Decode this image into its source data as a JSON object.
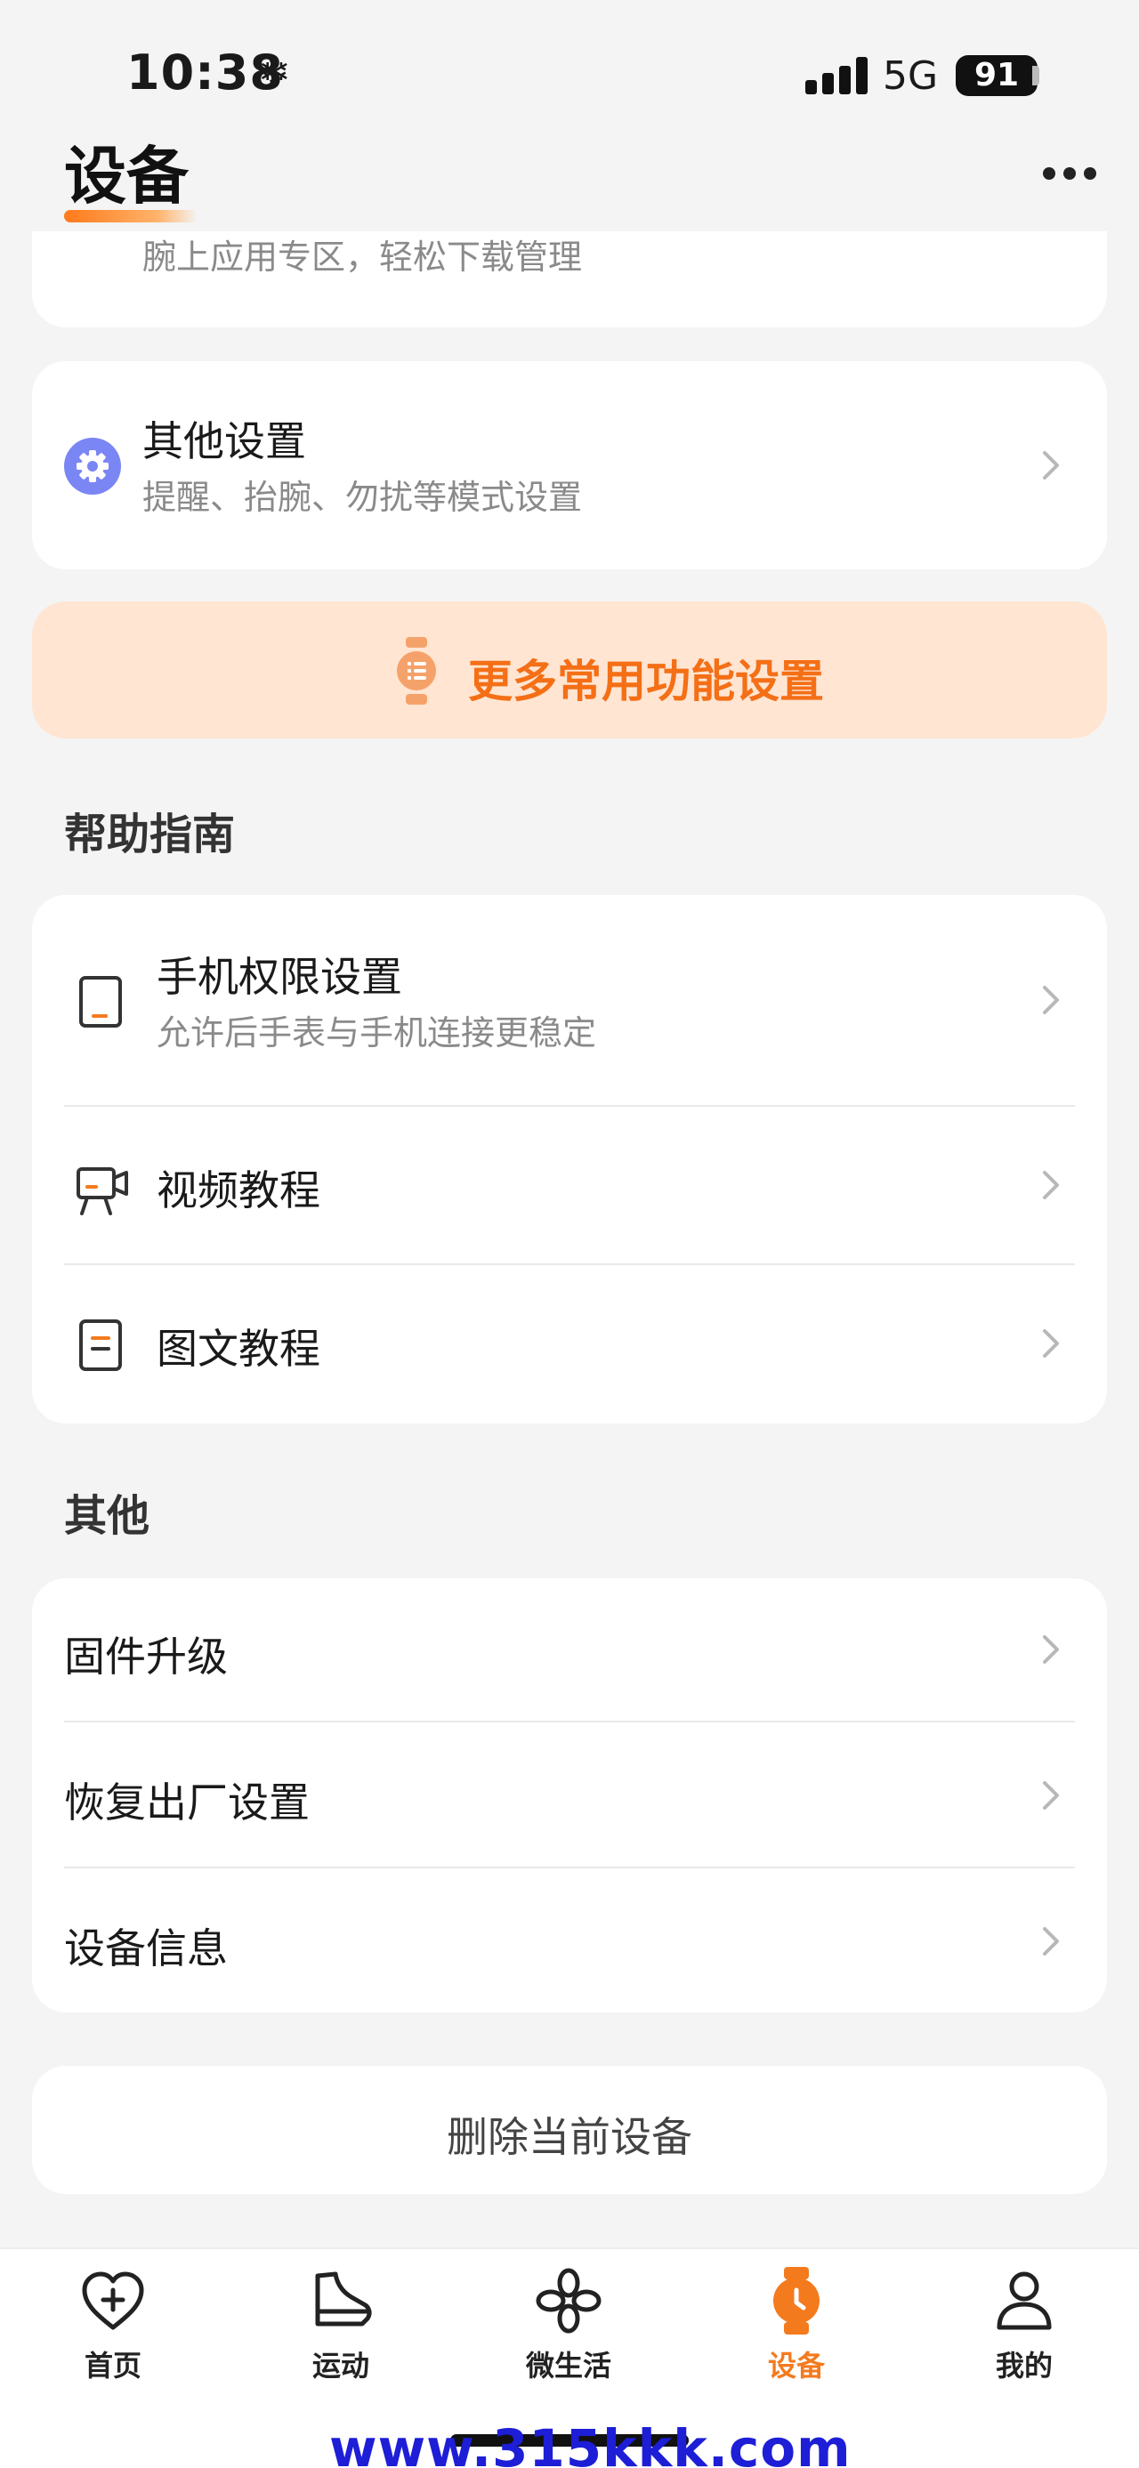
{
  "status_bar": {
    "time": "10:38",
    "network": "5G",
    "battery": "91"
  },
  "header": {
    "title": "设备"
  },
  "top_card": {
    "subtitle": "腕上应用专区，轻松下载管理"
  },
  "other_settings": {
    "title": "其他设置",
    "subtitle": "提醒、抬腕、勿扰等模式设置"
  },
  "banner": {
    "label": "更多常用功能设置"
  },
  "help": {
    "section_title": "帮助指南",
    "items": [
      {
        "title": "手机权限设置",
        "subtitle": "允许后手表与手机连接更稳定"
      },
      {
        "title": "视频教程"
      },
      {
        "title": "图文教程"
      }
    ]
  },
  "other": {
    "section_title": "其他",
    "items": [
      {
        "title": "固件升级"
      },
      {
        "title": "恢复出厂设置"
      },
      {
        "title": "设备信息"
      }
    ]
  },
  "delete_button": {
    "label": "删除当前设备"
  },
  "bottom_nav": {
    "items": [
      {
        "label": "首页",
        "icon": "heart-plus-icon"
      },
      {
        "label": "运动",
        "icon": "shoe-icon"
      },
      {
        "label": "微生活",
        "icon": "clover-icon"
      },
      {
        "label": "设备",
        "icon": "watch-icon",
        "active": true
      },
      {
        "label": "我的",
        "icon": "person-icon"
      }
    ]
  },
  "watermark": "www.315kkk.com",
  "colors": {
    "accent": "#f47a1e",
    "banner_bg": "#ffe5d2",
    "settings_icon": "#7b86f5",
    "card_bg": "#ffffff",
    "page_bg": "#f4f4f4"
  }
}
